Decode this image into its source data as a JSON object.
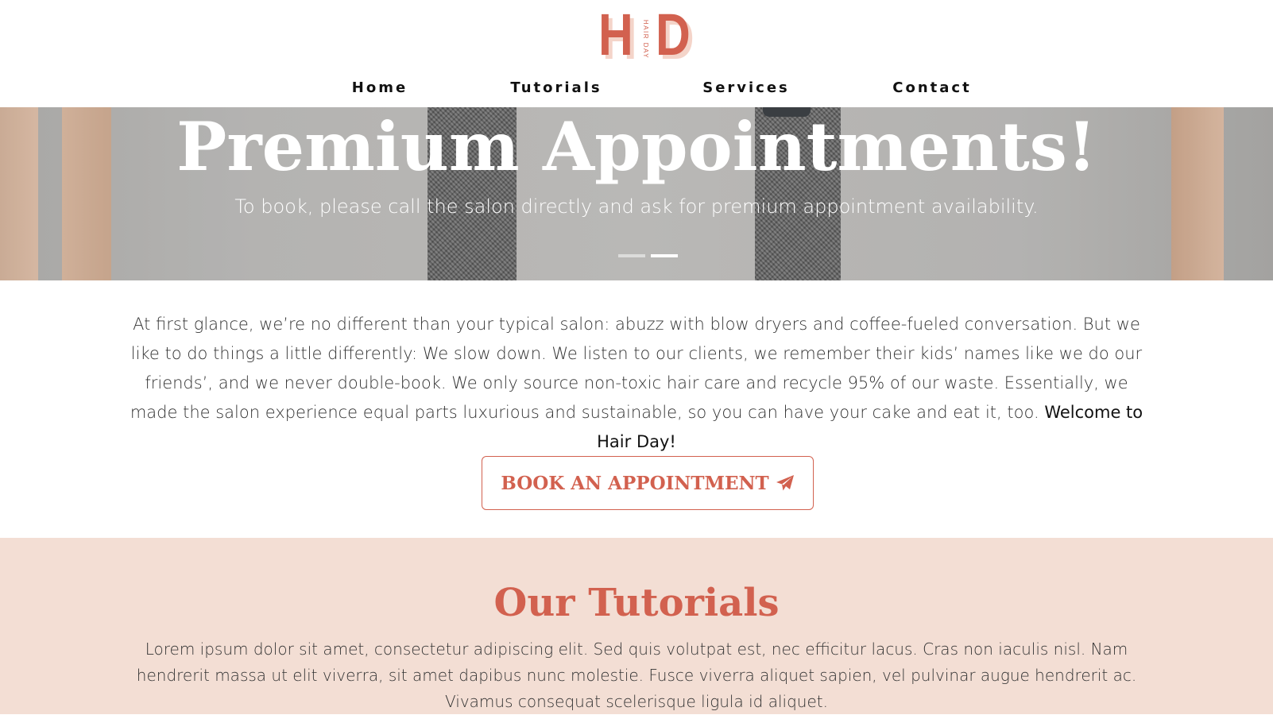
{
  "logo": {
    "letter_left": "H",
    "letter_right": "D",
    "sub": "HAIR DAY",
    "colors": {
      "brand": "#d2614f",
      "shadow": "#f4d4c9"
    }
  },
  "nav": {
    "items": [
      {
        "label": "Home"
      },
      {
        "label": "Tutorials"
      },
      {
        "label": "Services"
      },
      {
        "label": "Contact"
      }
    ]
  },
  "hero": {
    "title": "Premium Appointments!",
    "subtitle": "To book, please call the salon directly and ask for premium appointment availability.",
    "slides_total": 2,
    "active_slide": 2
  },
  "intro": {
    "text": "At first glance, we’re no different than your typical salon: abuzz with blow dryers and coffee-fueled conversation. But we like to do things a little differently: We slow down. We listen to our clients, we remember their kids’ names like we do our friends’, and we never double-book. We only source non-toxic hair care and recycle 95% of our waste. Essentially, we made the salon experience equal parts luxurious and sustainable, so you can have your cake and eat it, too.",
    "welcome": "Welcome to Hair Day!"
  },
  "book_button": {
    "label": "BOOK AN APPOINTMENT",
    "icon": "paper-plane-icon"
  },
  "tutorials": {
    "title": "Our Tutorials",
    "text": "Lorem ipsum dolor sit amet, consectetur adipiscing elit. Sed quis volutpat est, nec efficitur lacus. Cras non iaculis nisl. Nam hendrerit massa ut elit viverra, sit amet dapibus nunc molestie. Fusce viverra aliquet sapien, vel pulvinar augue hendrerit ac. Vivamus consequat scelerisque ligula id aliquet.",
    "background": "#f3ded4"
  }
}
